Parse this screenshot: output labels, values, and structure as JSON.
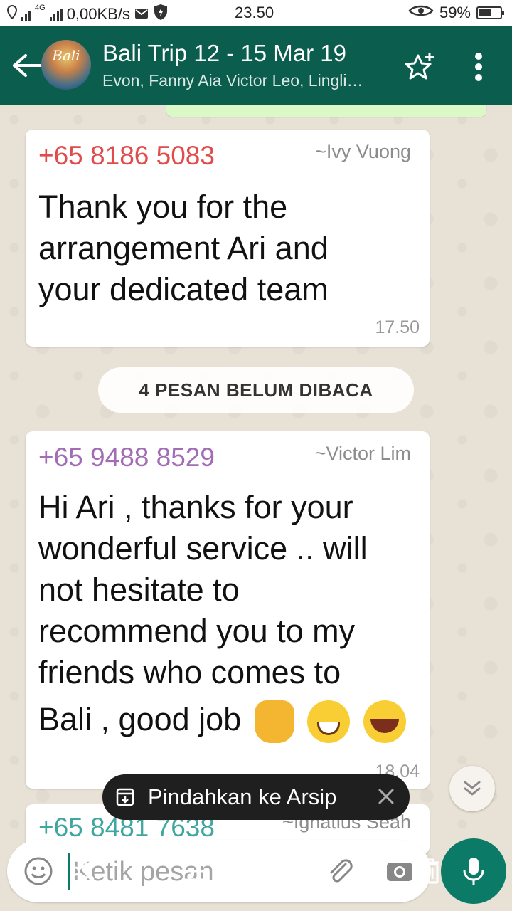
{
  "status_bar": {
    "network_type": "4G",
    "data_speed": "0,00KB/s",
    "time": "23.50",
    "battery": "59%",
    "battery_level": 0.59
  },
  "header": {
    "avatar_text": "Bali",
    "title": "Bali Trip 12 - 15 Mar 19",
    "participants": "Evon, Fanny Aia Victor Leo, Lingli…"
  },
  "messages": [
    {
      "sender_number": "+65 8186 5083",
      "sender_name": "~Ivy Vuong",
      "lines": [
        "Thank you for the",
        "arrangement Ari and",
        "your dedicated team"
      ],
      "time": "17.50",
      "number_color": "#e04b4b"
    },
    {
      "sender_number": "+65 9488 8529",
      "sender_name": "~Victor Lim",
      "lines": [
        "Hi Ari , thanks for your",
        "wonderful service .. will",
        "not hesitate to",
        "recommend you to my",
        "friends who comes to",
        "Bali , good job"
      ],
      "emojis": [
        "thumbs-up",
        "grinning-face",
        "rolling-on-floor-laughing"
      ],
      "time": "18.04",
      "number_color": "#a26db5"
    },
    {
      "sender_number": "+65 8481 7638",
      "sender_name": "~Ignatius Seah",
      "number_color": "#3fa6a0"
    }
  ],
  "unread_banner": "4 PESAN BELUM DIBACA",
  "toast": {
    "text": "Pindahkan ke Arsip"
  },
  "composer": {
    "placeholder": "Ketik pesan"
  },
  "colors": {
    "app_bar": "#0b5d4e",
    "accent": "#0b7a66",
    "chat_background": "#e8e1d6"
  }
}
